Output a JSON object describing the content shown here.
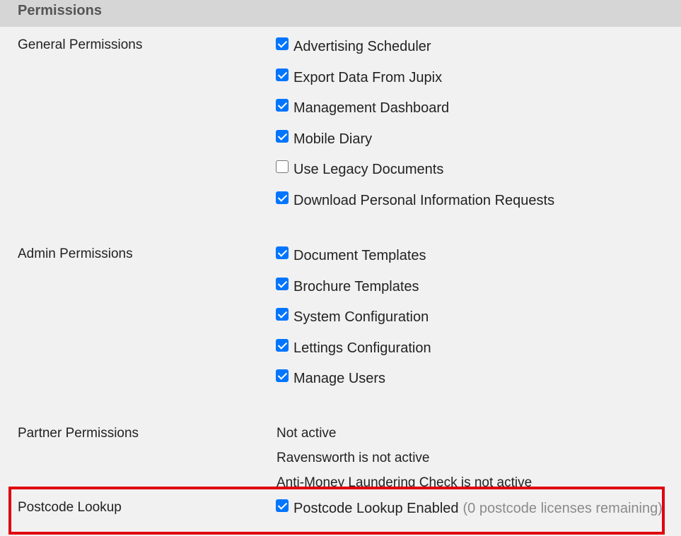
{
  "header": {
    "title": "Permissions"
  },
  "general": {
    "label": "General Permissions",
    "items": [
      {
        "label": "Advertising Scheduler",
        "checked": true
      },
      {
        "label": "Export Data From Jupix",
        "checked": true
      },
      {
        "label": "Management Dashboard",
        "checked": true
      },
      {
        "label": "Mobile Diary",
        "checked": true
      },
      {
        "label": "Use Legacy Documents",
        "checked": false
      },
      {
        "label": "Download Personal Information Requests",
        "checked": true
      }
    ]
  },
  "admin": {
    "label": "Admin Permissions",
    "items": [
      {
        "label": "Document Templates",
        "checked": true
      },
      {
        "label": "Brochure Templates",
        "checked": true
      },
      {
        "label": "System Configuration",
        "checked": true
      },
      {
        "label": "Lettings Configuration",
        "checked": true
      },
      {
        "label": "Manage Users",
        "checked": true
      }
    ]
  },
  "partner": {
    "label": "Partner Permissions",
    "lines": [
      "Not active",
      "Ravensworth is not active",
      "Anti-Money Laundering Check is not active"
    ]
  },
  "postcode": {
    "label": "Postcode Lookup",
    "item_label": "Postcode Lookup Enabled",
    "checked": true,
    "note": "(0 postcode licenses remaining)"
  },
  "colors": {
    "checkbox_checked": "#0075ff",
    "highlight_border": "#e0000f",
    "header_bg": "#d6d6d6",
    "page_bg": "#f1f1f1"
  }
}
